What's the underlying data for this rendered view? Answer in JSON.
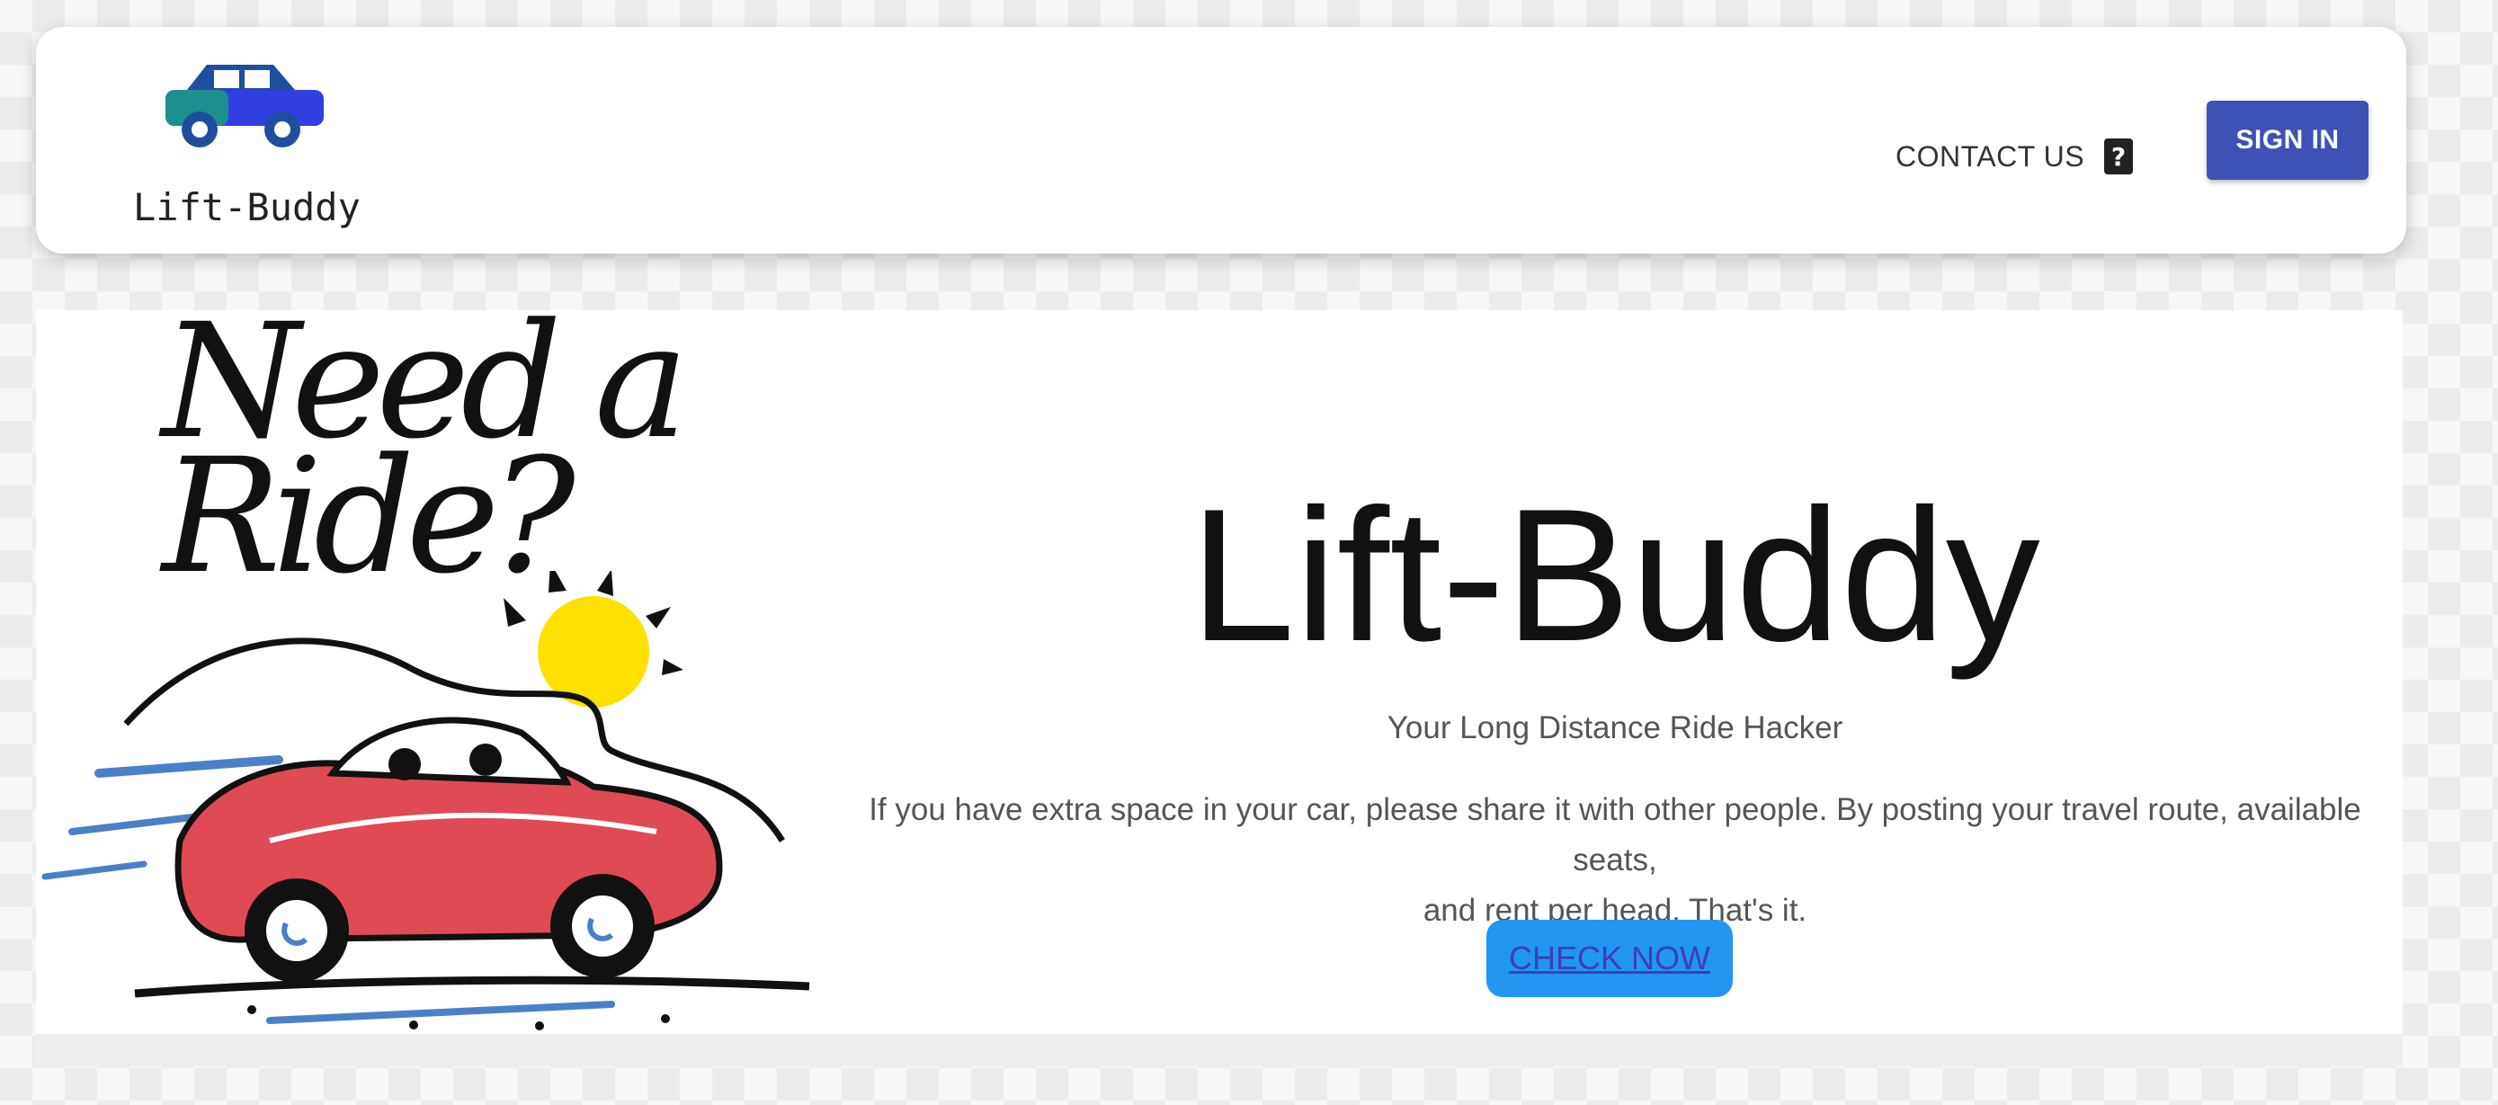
{
  "header": {
    "logo_text": "Lift-Buddy",
    "contact_label": "CONTACT US",
    "contact_icon": "help-icon",
    "signin_label": "SIGN IN"
  },
  "hero": {
    "illustration_text_line1": "Need a",
    "illustration_text_line2": "Ride?",
    "title": "Lift-Buddy",
    "subtitle": "Your Long Distance Ride Hacker",
    "description_line1": "If you have extra space in your car, please share it with other people. By posting your travel route, available seats,",
    "description_line2": "and rent per head. That's it.",
    "cta_label": "CHECK NOW"
  },
  "colors": {
    "primary": "#3f51b5",
    "cta": "#2196f3",
    "cta_text": "#3f3fb0",
    "car_red": "#e04a55",
    "sun_yellow": "#ffe000"
  }
}
